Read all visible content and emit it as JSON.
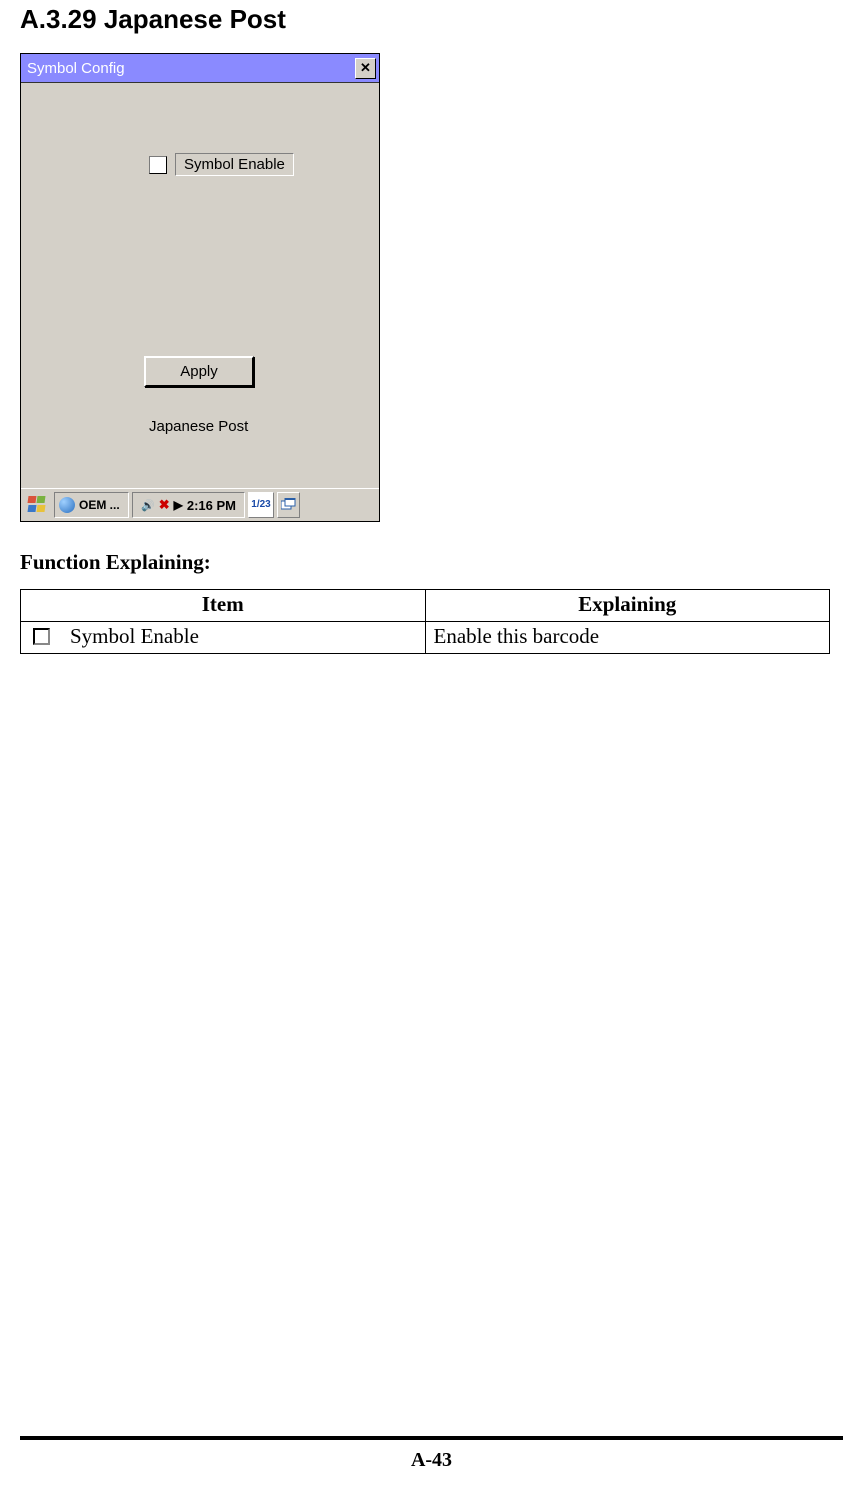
{
  "heading": "A.3.29 Japanese Post",
  "screenshot": {
    "title": "Symbol Config",
    "checkbox_label": "Symbol Enable",
    "apply_label": "Apply",
    "tab_label": "Japanese Post",
    "taskbar": {
      "oem_label": "OEM ...",
      "time": "2:16 PM",
      "ime": "1/23"
    }
  },
  "function_explaining_heading": "Function Explaining:",
  "table": {
    "headers": {
      "item": "Item",
      "explaining": "Explaining"
    },
    "row": {
      "item": "Symbol Enable",
      "explaining": "Enable this barcode"
    }
  },
  "page_number": "A-43"
}
